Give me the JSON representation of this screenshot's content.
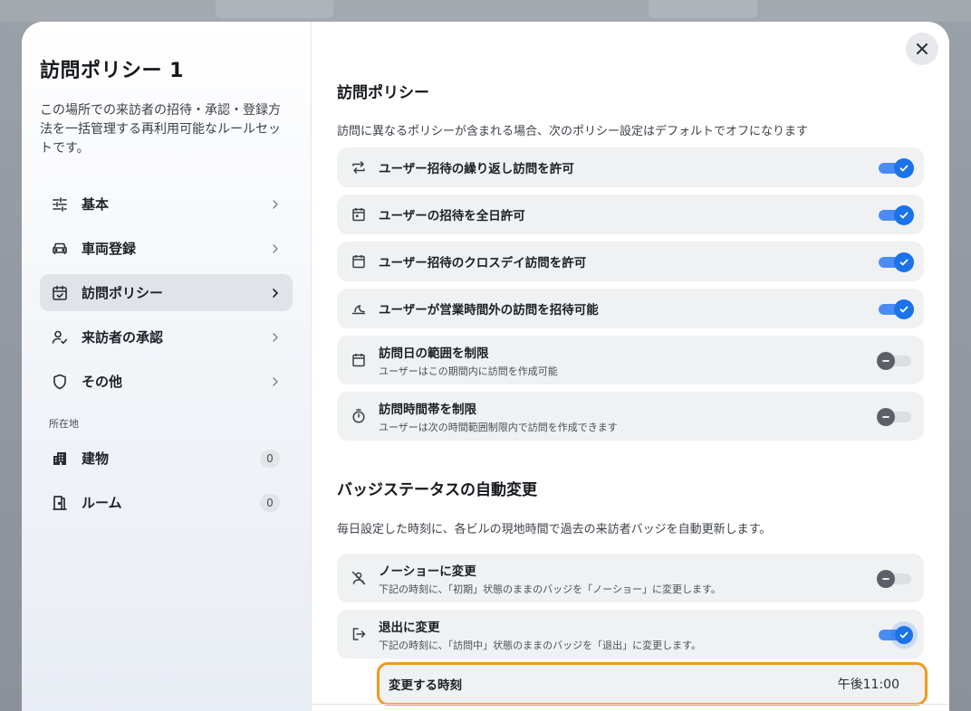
{
  "left": {
    "title": "訪問ポリシー 1",
    "description": "この場所での来訪者の招待・承認・登録方法を一括管理する再利用可能なルールセットです。",
    "nav": [
      {
        "label": "基本",
        "icon": "sliders-icon"
      },
      {
        "label": "車両登録",
        "icon": "car-icon"
      },
      {
        "label": "訪問ポリシー",
        "icon": "calendar-check-icon"
      },
      {
        "label": "来訪者の承認",
        "icon": "person-check-icon"
      },
      {
        "label": "その他",
        "icon": "shield-icon"
      }
    ],
    "section_label": "所在地",
    "locations": [
      {
        "label": "建物",
        "count": "0",
        "icon": "building-icon"
      },
      {
        "label": "ルーム",
        "count": "0",
        "icon": "door-icon"
      }
    ]
  },
  "policy": {
    "heading": "訪問ポリシー",
    "note": "訪問に異なるポリシーが含まれる場合、次のポリシー設定はデフォルトでオフになります",
    "rows": [
      {
        "title": "ユーザー招待の繰り返し訪問を許可",
        "note": "",
        "enabled": true,
        "icon": "repeat-icon"
      },
      {
        "title": "ユーザーの招待を全日許可",
        "note": "",
        "enabled": true,
        "icon": "calendar-day-icon"
      },
      {
        "title": "ユーザー招待のクロスデイ訪問を許可",
        "note": "",
        "enabled": true,
        "icon": "calendar-icon"
      },
      {
        "title": "ユーザーが営業時間外の訪問を招待可能",
        "note": "",
        "enabled": true,
        "icon": "moon-icon"
      },
      {
        "title": "訪問日の範囲を制限",
        "note": "ユーザーはこの期間内に訪問を作成可能",
        "enabled": false,
        "icon": "calendar-range-icon"
      },
      {
        "title": "訪問時間帯を制限",
        "note": "ユーザーは次の時間範囲制限内で訪問を作成できます",
        "enabled": false,
        "icon": "stopwatch-icon"
      }
    ]
  },
  "badge": {
    "heading": "バッジステータスの自動変更",
    "note": "毎日設定した時刻に、各ビルの現地時間で過去の来訪者バッジを自動更新します。",
    "rows": [
      {
        "title": "ノーショーに変更",
        "note": "下記の時刻に、「初期」状態のままのバッジを「ノーショー」に変更します。",
        "enabled": false,
        "icon": "person-off-icon"
      },
      {
        "title": "退出に変更",
        "note": "下記の時刻に、「訪問中」状態のままのバッジを「退出」に変更します。",
        "enabled": true,
        "icon": "exit-icon"
      }
    ],
    "time_label": "変更する時刻",
    "time_value": "午後11:00"
  },
  "colors": {
    "accent": "#1a73e8",
    "focus": "#f09a1c"
  }
}
